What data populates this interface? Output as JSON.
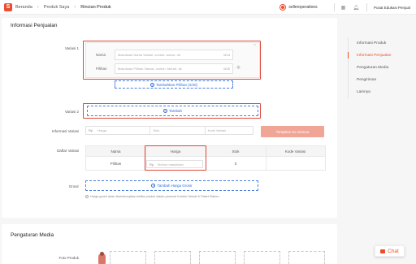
{
  "header": {
    "breadcrumb": [
      "Beranda",
      "Produk Saya",
      "Rincian Produk"
    ],
    "separators": [
      "›",
      "›"
    ],
    "seller_name": "selleroperations",
    "help_center": "Pusat Edukasi Penjual",
    "icons": [
      "seller-avatar-icon",
      "grid-icon",
      "bell-icon"
    ],
    "accent_color": "#ee4d2d"
  },
  "sales_info": {
    "title": "Informasi Penjualan",
    "variation1": {
      "label": "Variasi 1",
      "name_label": "Nama",
      "name_placeholder": "Masukkan Nama Variasi, contoh: warna, dll.",
      "name_count": "0/14",
      "options_label": "Pilihan",
      "options_placeholder": "Masukkan Pilihan Variasi, contoh: Merah, dll.",
      "options_count": "0/20",
      "add_option_button": "Tambahkan Pilihan (2/20)"
    },
    "variation2": {
      "label": "Variasi 2",
      "add_button": "Tambah"
    },
    "variation_info": {
      "label": "Informasi Variasi",
      "currency": "Rp",
      "price_placeholder": "Harga",
      "stock_placeholder": "Stok",
      "sku_placeholder": "Kode Variasi",
      "apply_all_button": "Terapkan Ke Semua"
    },
    "variation_list": {
      "label": "Daftar Variasi",
      "columns": [
        "Nama",
        "Harga",
        "Stok",
        "Kode Variasi"
      ],
      "row": {
        "name": "Pilihan",
        "currency": "Rp",
        "price_placeholder": "Mohon masukkan",
        "stock": "0",
        "sku": ""
      }
    },
    "wholesale": {
      "label": "Grosir",
      "add_button": "Tambah Harga Grosir",
      "note": "Harga grosir akan disembunyikan ketika produk dalam promosi Kombo Hemat & Paket Diskon."
    }
  },
  "media": {
    "title": "Pengaturan Media",
    "photo_label": "Foto Produk"
  },
  "right_nav": {
    "items": [
      "Informasi Produk",
      "Informasi Penjualan",
      "Pengaturan Media",
      "Pengiriman",
      "Lainnya"
    ],
    "active_index": 1
  },
  "chat": {
    "label": "Chat"
  }
}
